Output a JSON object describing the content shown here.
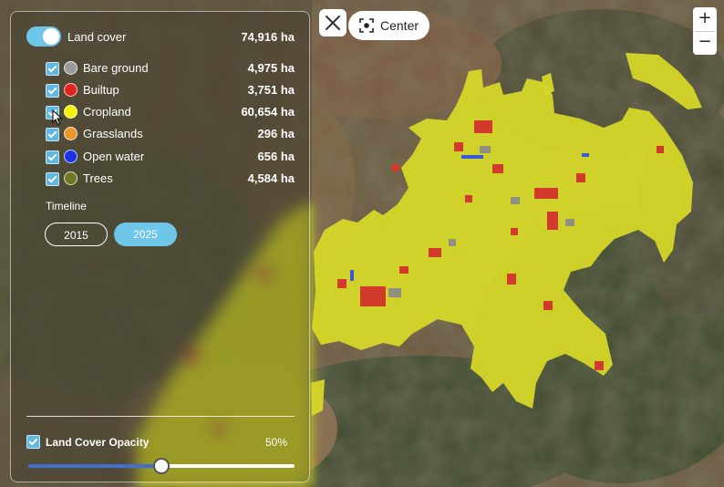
{
  "map": {
    "colors": {
      "cropland": "#d7d928",
      "builtup": "#d23a2c",
      "bare_ground": "#8a8a8a",
      "open_water": "#3b5ad8",
      "trees": "#6d7a2a"
    }
  },
  "panel": {
    "land_cover": {
      "label": "Land cover",
      "total": "74,916 ha",
      "enabled": true
    },
    "classes": [
      {
        "label": "Bare ground",
        "value": "4,975 ha",
        "color": "#9a9a9a",
        "checked": true
      },
      {
        "label": "Builtup",
        "value": "3,751 ha",
        "color": "#e0241c",
        "checked": true
      },
      {
        "label": "Cropland",
        "value": "60,654 ha",
        "color": "#f4f20a",
        "checked": true
      },
      {
        "label": "Grasslands",
        "value": "296 ha",
        "color": "#ea962a",
        "checked": true
      },
      {
        "label": "Open water",
        "value": "656 ha",
        "color": "#1834e6",
        "checked": true
      },
      {
        "label": "Trees",
        "value": "4,584 ha",
        "color": "#6b7a22",
        "checked": true
      }
    ],
    "timeline": {
      "label": "Timeline",
      "years": [
        "2015",
        "2025"
      ],
      "selected": "2025"
    },
    "opacity": {
      "label": "Land Cover Opacity",
      "value_text": "50%",
      "value": 0.5,
      "checked": true
    }
  },
  "controls": {
    "center_label": "Center",
    "zoom_in": "+",
    "zoom_out": "−"
  }
}
